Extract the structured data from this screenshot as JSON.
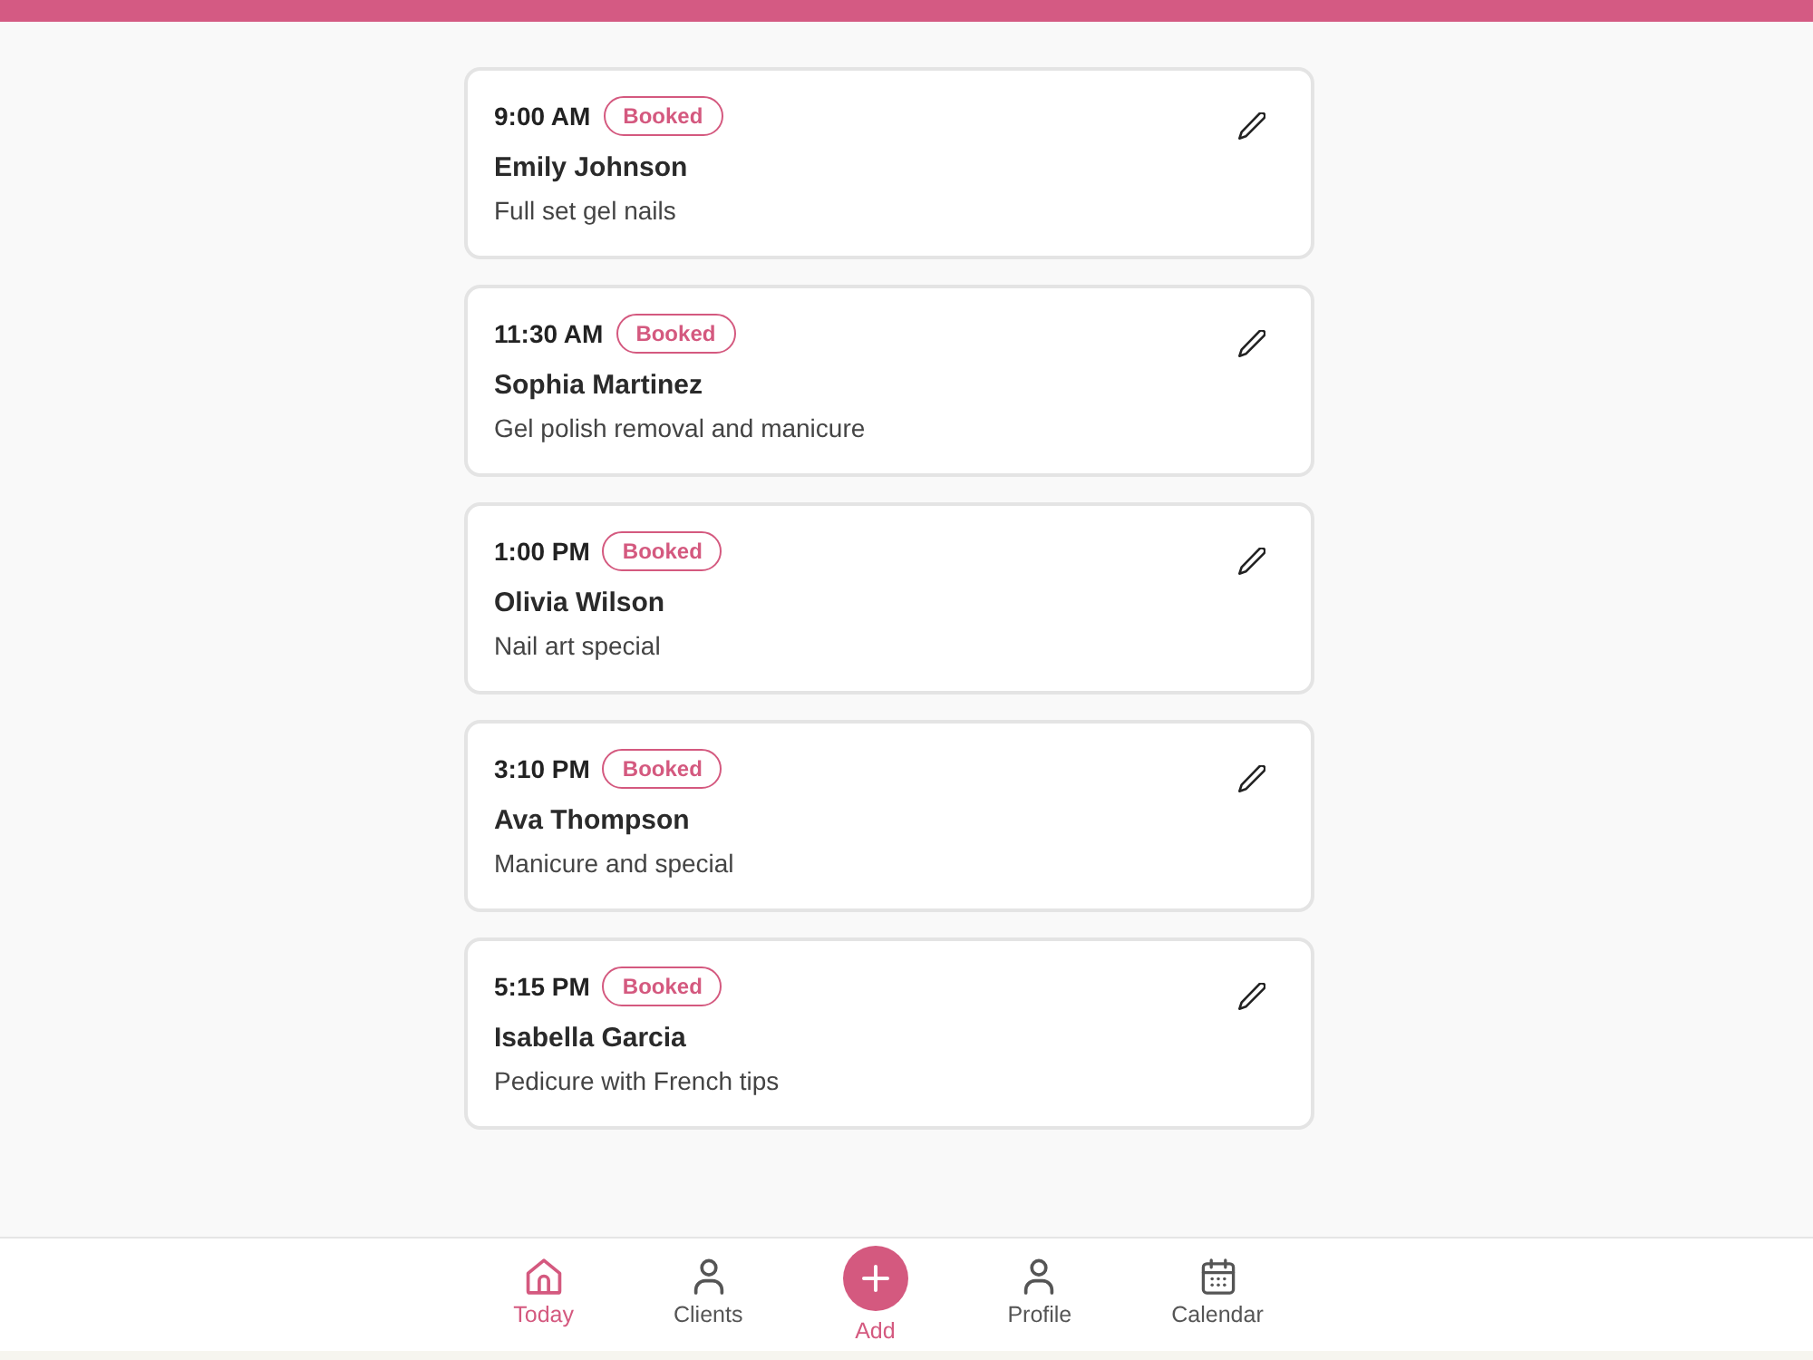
{
  "appointments": [
    {
      "time": "9:00 AM",
      "status": "Booked",
      "client": "Emily Johnson",
      "service": "Full set gel nails"
    },
    {
      "time": "11:30 AM",
      "status": "Booked",
      "client": "Sophia Martinez",
      "service": "Gel polish removal and manicure"
    },
    {
      "time": "1:00 PM",
      "status": "Booked",
      "client": "Olivia Wilson",
      "service": "Nail art special"
    },
    {
      "time": "3:10 PM",
      "status": "Booked",
      "client": "Ava Thompson",
      "service": "Manicure and special"
    },
    {
      "time": "5:15 PM",
      "status": "Booked",
      "client": "Isabella Garcia",
      "service": "Pedicure with French tips"
    }
  ],
  "bottom_nav": [
    {
      "label": "Today",
      "kind": "home",
      "selected": true
    },
    {
      "label": "Clients",
      "kind": "person",
      "selected": false
    },
    {
      "label": "Add",
      "kind": "add"
    },
    {
      "label": "Profile",
      "kind": "person",
      "selected": false
    },
    {
      "label": "Calendar",
      "kind": "calendar",
      "selected": false
    }
  ]
}
